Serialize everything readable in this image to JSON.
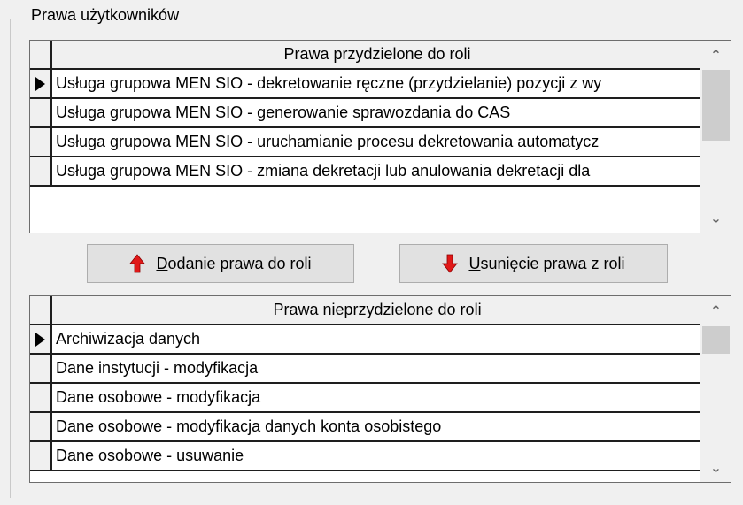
{
  "groupbox": {
    "title": "Prawa użytkowników"
  },
  "assigned_grid": {
    "header": "Prawa przydzielone do roli",
    "current_row": 0,
    "rows": [
      "Usługa grupowa MEN SIO - dekretowanie ręczne (przydzielanie) pozycji z wy",
      "Usługa grupowa MEN SIO - generowanie sprawozdania do CAS",
      "Usługa grupowa MEN SIO - uruchamianie procesu dekretowania automatycz",
      "Usługa grupowa MEN SIO - zmiana dekretacji lub anulowania dekretacji dla"
    ]
  },
  "buttons": {
    "add": {
      "accel": "D",
      "rest": "odanie prawa do roli",
      "icon": "red-up-arrow-icon"
    },
    "remove": {
      "accel": "U",
      "rest": "sunięcie prawa z roli",
      "icon": "red-down-arrow-icon"
    }
  },
  "unassigned_grid": {
    "header": "Prawa nieprzydzielone do roli",
    "current_row": 0,
    "rows": [
      "Archiwizacja danych",
      "Dane instytucji - modyfikacja",
      "Dane osobowe - modyfikacja",
      "Dane osobowe - modyfikacja danych konta osobistego",
      "Dane osobowe - usuwanie"
    ]
  },
  "scrollbar": {
    "up_glyph": "⌃",
    "down_glyph": "⌄"
  },
  "colors": {
    "arrow_red": "#e01818",
    "window_bg": "#f0f0f0",
    "grid_bg": "#ffffff"
  }
}
